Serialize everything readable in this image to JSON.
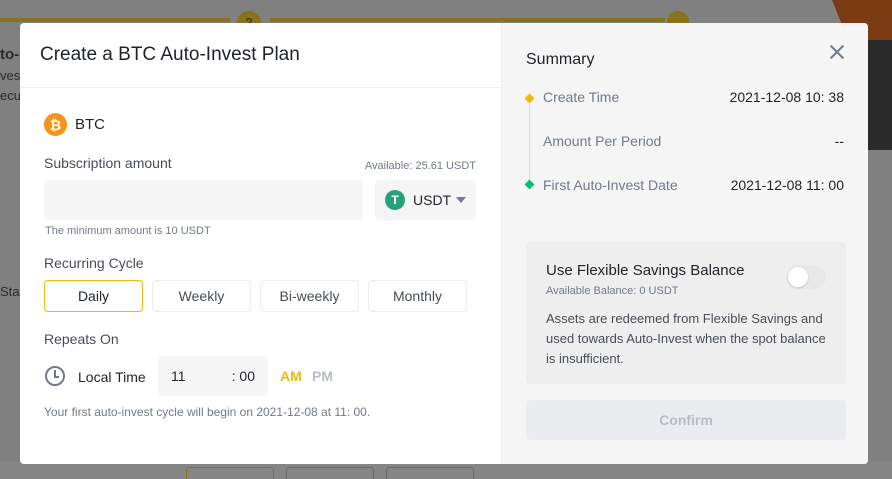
{
  "background": {
    "step_number": "2",
    "left_texts": [
      "to-",
      "ves",
      "ecu",
      "Sta"
    ]
  },
  "modal": {
    "title": "Create a BTC Auto-Invest Plan",
    "coin": {
      "icon": "bitcoin-icon",
      "symbol_glyph": "₿",
      "name": "BTC"
    },
    "subscription": {
      "label": "Subscription amount",
      "available": "Available: 25.61 USDT",
      "amount_value": "",
      "amount_placeholder": "",
      "currency": "USDT",
      "currency_icon_glyph": "T",
      "min_note": "The minimum amount is 10 USDT"
    },
    "recurring": {
      "label": "Recurring Cycle",
      "options": [
        "Daily",
        "Weekly",
        "Bi-weekly",
        "Monthly"
      ],
      "selected": "Daily"
    },
    "repeats": {
      "label": "Repeats On",
      "local_time_label": "Local Time",
      "hour": "11",
      "minute": ": 00",
      "am": "AM",
      "pm": "PM",
      "selected_period": "AM",
      "note": "Your first auto-invest cycle will begin on 2021-12-08 at 11: 00."
    }
  },
  "summary": {
    "title": "Summary",
    "rows": [
      {
        "label": "Create Time",
        "value": "2021-12-08 10: 38",
        "dot_color": "#f0b90b"
      },
      {
        "label": "Amount Per Period",
        "value": "--",
        "dot_color": ""
      },
      {
        "label": "First Auto-Invest Date",
        "value": "2021-12-08 11: 00",
        "dot_color": "#02c076"
      }
    ],
    "flexible": {
      "title": "Use Flexible Savings Balance",
      "available": "Available Balance: 0 USDT",
      "description": "Assets are redeemed from Flexible Savings and used towards Auto-Invest when the spot balance is insufficient.",
      "enabled": false
    },
    "confirm_label": "Confirm"
  },
  "colors": {
    "accent": "#f0b90b",
    "btc": "#f7931a",
    "usdt": "#26a17b",
    "success": "#02c076"
  }
}
